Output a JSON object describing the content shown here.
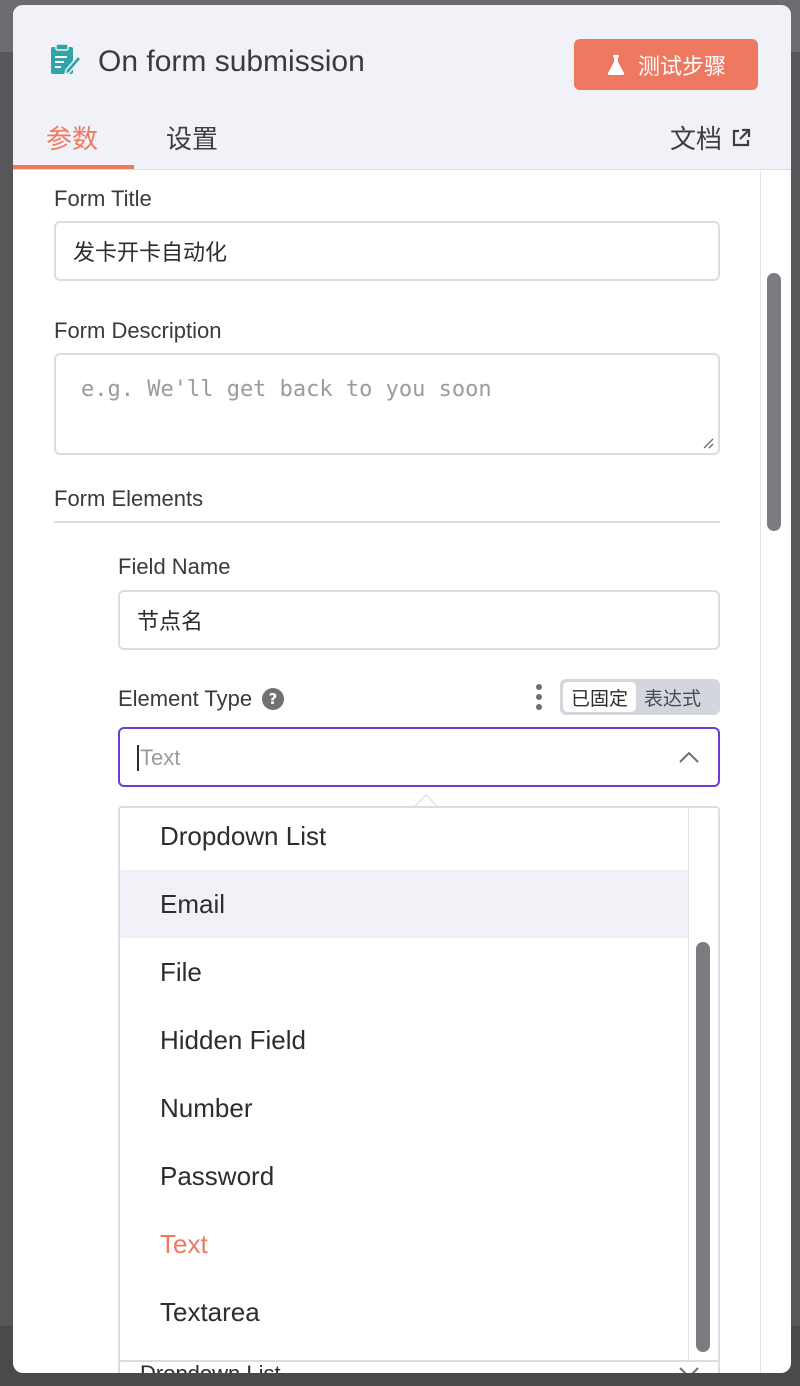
{
  "header": {
    "title": "On form submission",
    "test_button": "测试步骤",
    "tabs": [
      {
        "label": "参数",
        "active": true
      },
      {
        "label": "设置",
        "active": false
      }
    ],
    "docs_link": "文档"
  },
  "form": {
    "title_label": "Form Title",
    "title_value": "发卡开卡自动化",
    "description_label": "Form Description",
    "description_placeholder": "e.g. We'll get back to you soon",
    "elements_label": "Form Elements",
    "field_name_label": "Field Name",
    "field_name_value": "节点名",
    "element_type_label": "Element Type",
    "mode_toggle": {
      "fixed": "已固定",
      "expression": "表达式",
      "selected": "fixed"
    },
    "element_type_placeholder": "Text",
    "next_select_value": "Dropdown List"
  },
  "dropdown": {
    "options": [
      "Dropdown List",
      "Email",
      "File",
      "Hidden Field",
      "Number",
      "Password",
      "Text",
      "Textarea"
    ],
    "hovered": "Email",
    "selected": "Text"
  },
  "colors": {
    "accent": "#ee7860",
    "focus": "#6a3fcf",
    "node_icon": "#2fa5a8"
  }
}
